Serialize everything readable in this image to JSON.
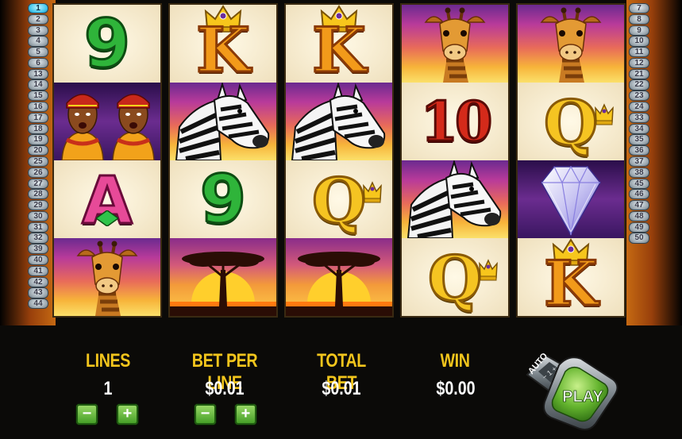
{
  "lines_left": [
    "1",
    "2",
    "3",
    "4",
    "5",
    "6",
    "13",
    "14",
    "15",
    "16",
    "17",
    "18",
    "19",
    "20",
    "25",
    "26",
    "27",
    "28",
    "29",
    "30",
    "31",
    "32",
    "39",
    "40",
    "41",
    "42",
    "43",
    "44"
  ],
  "lines_right": [
    "7",
    "8",
    "9",
    "10",
    "11",
    "12",
    "21",
    "22",
    "23",
    "24",
    "33",
    "34",
    "35",
    "36",
    "37",
    "38",
    "45",
    "46",
    "47",
    "48",
    "49",
    "50"
  ],
  "active_line": "1",
  "reels": [
    [
      "nine",
      "tribal-women",
      "ace",
      "giraffe"
    ],
    [
      "king",
      "zebra",
      "nine",
      "acacia-tree"
    ],
    [
      "king",
      "zebra",
      "queen",
      "acacia-tree"
    ],
    [
      "giraffe",
      "ten",
      "zebra",
      "queen"
    ],
    [
      "giraffe",
      "queen",
      "diamond",
      "king"
    ]
  ],
  "symbol_text": {
    "nine": "9",
    "ten": "10",
    "king": "K",
    "queen": "Q",
    "ace": "A"
  },
  "panel": {
    "lines_label": "LINES",
    "lines_value": "1",
    "bet_per_line_label": "BET PER LINE",
    "bet_per_line_value": "$0.01",
    "total_bet_label": "TOTAL BET",
    "total_bet_value": "$0.01",
    "win_label": "WIN",
    "win_value": "$0.00",
    "minus": "−",
    "plus": "+",
    "auto_label": "AUTO",
    "play_label": "PLAY"
  },
  "colors": {
    "label": "#f2c51c",
    "value": "#ffffff",
    "button_green": "#3f9a22",
    "active_line": "#3ec3ea"
  }
}
